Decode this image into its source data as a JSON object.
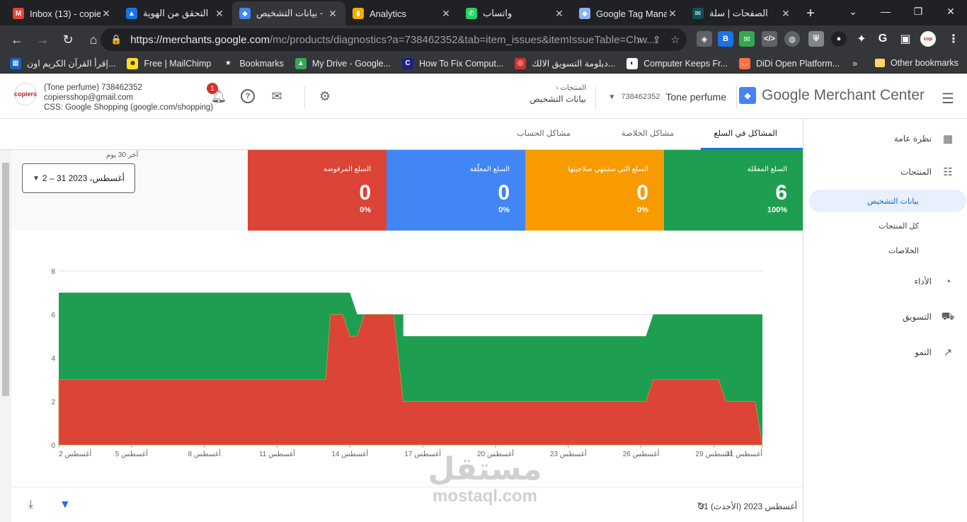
{
  "browser": {
    "tabs": [
      {
        "title": "Inbox (13) - copie",
        "icon": "gmail-icon",
        "color": "#ea4335",
        "glyph": "M"
      },
      {
        "title": "التحقق من الهوية",
        "icon": "google-ads-icon",
        "color": "#1a73e8",
        "glyph": "▲"
      },
      {
        "title": "بيانات التشخيص -",
        "icon": "merchant-center-icon",
        "color": "#4285f4",
        "glyph": "◆",
        "active": true
      },
      {
        "title": "Analytics",
        "icon": "analytics-icon",
        "color": "#f9ab00",
        "glyph": "▮"
      },
      {
        "title": "واتساب",
        "icon": "whatsapp-icon",
        "color": "#25d366",
        "glyph": "✆"
      },
      {
        "title": "Google Tag Mana",
        "icon": "tag-manager-icon",
        "color": "#8ab4f8",
        "glyph": "◆"
      },
      {
        "title": "الصفحات | سلة",
        "icon": "salla-icon",
        "color": "#0f5156",
        "glyph": "✉"
      }
    ],
    "url_host": "https://merchants.google.com",
    "url_path": "/mc/products/diagnostics?a=738462352&tab=item_issues&itemIssueTable=Chw...",
    "bookmarks": [
      {
        "label": "إقرأ القرآن الكريم اون...",
        "color": "#1565c0",
        "glyph": "▦"
      },
      {
        "label": "Free | MailChimp",
        "color": "#ffe01b",
        "glyph": "☻"
      },
      {
        "label": "Bookmarks",
        "color": "#35363a",
        "glyph": "★"
      },
      {
        "label": "My Drive - Google...",
        "color": "#34a853",
        "glyph": "▲"
      },
      {
        "label": "How To Fix Comput...",
        "color": "#1a237e",
        "glyph": "C"
      },
      {
        "label": "دبلومة التسويق الالك...",
        "color": "#d32f2f",
        "glyph": "◎"
      },
      {
        "label": "Computer Keeps Fr...",
        "color": "#fafafa",
        "glyph": "◐"
      },
      {
        "label": "DiDi Open Platform...",
        "color": "#ff7043",
        "glyph": "◡"
      }
    ],
    "bookmarks_more": "»",
    "other_bookmarks": "Other bookmarks"
  },
  "header": {
    "product_name": "Google Merchant Center",
    "account_name": "Tone perfume",
    "account_id": "738462352",
    "crumb_parent": "المنتجات",
    "crumb_current": "بيانات التشخيص",
    "notification_count": "1",
    "merchant_line1": "(Tone perfume) 738462352",
    "merchant_line2": "copiersshop@gmail.com",
    "merchant_line3": "CSS: Google Shopping (google.com/shopping)",
    "merchant_logo_text": "copiers"
  },
  "sidebar": {
    "overview": "نظرة عامة",
    "products": "المنتجات",
    "diagnostics": "بيانات التشخيص",
    "all_products": "كل المنتجات",
    "feeds": "الخلاصات",
    "performance": "الأداء",
    "marketing": "التسويق",
    "growth": "النمو"
  },
  "tabs": {
    "item_issues": "المشاكل في السلع",
    "feed_issues": "مشاكل الخلاصة",
    "account_issues": "مشاكل الحساب"
  },
  "date_range": {
    "label": "آخر 30 يوم",
    "value": "2 – 31 أغسطس، 2023"
  },
  "cards": [
    {
      "label": "السلع المفعّلة",
      "value": "6",
      "pct": "100%",
      "color": "#1e9e50"
    },
    {
      "label": "السلع التي ستنتهي صلاحيتها",
      "value": "0",
      "pct": "0%",
      "color": "#f79b00"
    },
    {
      "label": "السلع المعلّقة",
      "value": "0",
      "pct": "0%",
      "color": "#4285f4"
    },
    {
      "label": "السلع المرفوضة",
      "value": "0",
      "pct": "0%",
      "color": "#db4437"
    }
  ],
  "chart_data": {
    "type": "area",
    "y_ticks": [
      "0",
      "2",
      "4",
      "6",
      "8"
    ],
    "ylim": [
      0,
      8
    ],
    "x_tick_labels": [
      "2 أغسطس",
      "5 أغسطس",
      "8 أغسطس",
      "11 أغسطس",
      "14 أغسطس",
      "17 أغسطس",
      "20 أغسطس",
      "23 أغسطس",
      "26 أغسطس",
      "29 أغسطس",
      "31 أغسطس"
    ],
    "x_tick_days": [
      2,
      5,
      8,
      11,
      14,
      17,
      20,
      23,
      26,
      29,
      31
    ],
    "xlim": [
      2,
      31
    ],
    "series": [
      {
        "color": "#1e9e50",
        "points": [
          [
            2,
            7
          ],
          [
            14,
            7
          ],
          [
            14.3,
            6
          ],
          [
            31,
            6
          ]
        ],
        "upper": [
          [
            2,
            7
          ],
          [
            14,
            7
          ],
          [
            14.3,
            6
          ],
          [
            16.2,
            6
          ],
          [
            16.2,
            5
          ],
          [
            26.2,
            5
          ],
          [
            26.5,
            6
          ],
          [
            31,
            6
          ]
        ]
      },
      {
        "color": "#db4437",
        "points": [
          [
            2,
            3
          ],
          [
            13,
            3
          ],
          [
            13.2,
            6
          ],
          [
            13.7,
            6
          ],
          [
            14,
            5
          ],
          [
            14.3,
            5
          ],
          [
            14.6,
            6
          ],
          [
            15.8,
            6
          ],
          [
            16.2,
            2
          ],
          [
            26.2,
            2
          ],
          [
            26.5,
            3
          ],
          [
            29.2,
            3
          ],
          [
            29.5,
            2
          ],
          [
            30.7,
            2
          ],
          [
            31,
            0
          ]
        ]
      }
    ]
  },
  "footer": {
    "date": "31 أغسطس 2023 (الأحدث)"
  },
  "watermark": {
    "arabic": "مستقل",
    "latin": "mostaql.com"
  }
}
